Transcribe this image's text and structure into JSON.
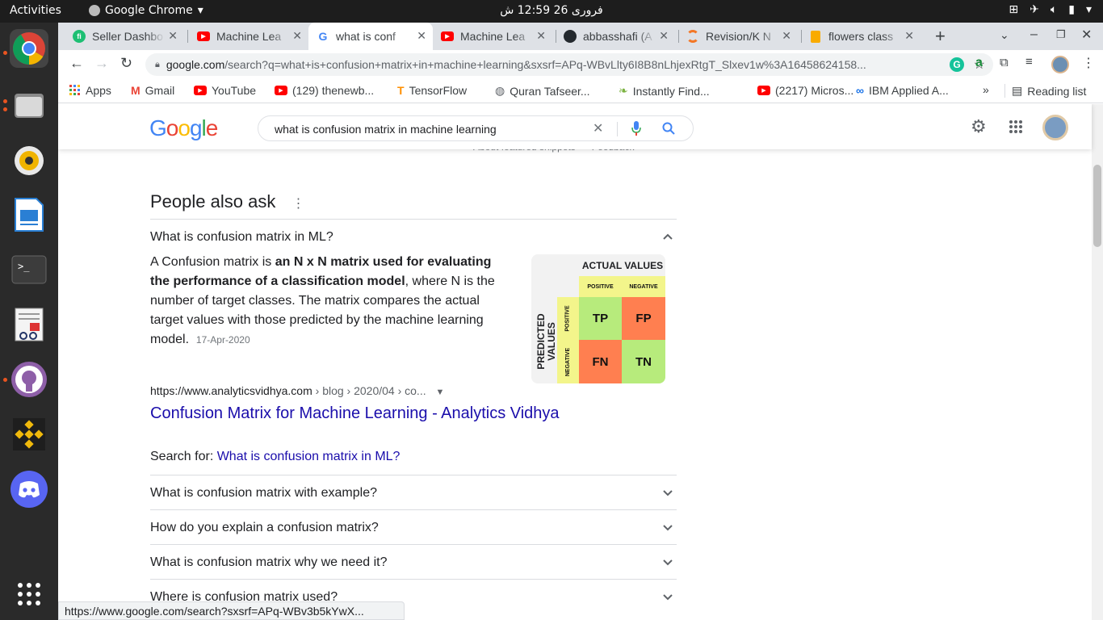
{
  "system": {
    "activities": "Activities",
    "app_name": "Google Chrome",
    "clock": "فروری 26  12:59 ش"
  },
  "tabs": [
    {
      "title": "Seller Dashbo",
      "favicon": "fiverr-icon",
      "color": "#1dbf73"
    },
    {
      "title": "Machine Lea",
      "favicon": "youtube-icon",
      "color": "#ff0000"
    },
    {
      "title": "what is conf",
      "favicon": "google-icon",
      "color": "#4285f4"
    },
    {
      "title": "Machine Lea",
      "favicon": "youtube-icon",
      "color": "#ff0000"
    },
    {
      "title": "abbasshafi (A",
      "favicon": "github-icon",
      "color": "#24292e"
    },
    {
      "title": "Revision/K N",
      "favicon": "jupyter-icon",
      "color": "#f37726"
    },
    {
      "title": "flowers class",
      "favicon": "notebook-icon",
      "color": "#f9ab00"
    }
  ],
  "toolbar": {
    "url_host": "google.com",
    "url_path": "/search?q=what+is+confusion+matrix+in+machine+learning&sxsrf=APq-WBvLlty6I8B8nLhjexRtgT_Slxev1w%3A16458624158..."
  },
  "bookmarks": [
    {
      "label": "Apps"
    },
    {
      "label": "Gmail"
    },
    {
      "label": "YouTube"
    },
    {
      "label": "(129) thenewb..."
    },
    {
      "label": "TensorFlow"
    },
    {
      "label": "Quran Tafseer..."
    },
    {
      "label": "Instantly Find..."
    },
    {
      "label": "(2217) Micros..."
    },
    {
      "label": "IBM Applied A..."
    }
  ],
  "bookmarks_more": "»",
  "reading_list": "Reading list",
  "search": {
    "query": "what is confusion matrix in machine learning"
  },
  "results": {
    "faded_top": "About featured snippets      Feedback",
    "paa_title": "People also ask",
    "expanded_question": "What is confusion matrix in ML?",
    "answer_pre": "A Confusion matrix is ",
    "answer_bold": "an N x N matrix used for evaluating the performance of a classification model",
    "answer_post": ", where N is the number of target classes. The matrix compares the actual target values with those predicted by the machine learning model.",
    "answer_date": "17-Apr-2020",
    "source_url": "https://www.analyticsvidhya.com",
    "source_crumb": " › blog › 2020/04 › co...",
    "result_title": "Confusion Matrix for Machine Learning - Analytics Vidhya",
    "search_for_label": "Search for: ",
    "search_for_link": "What is confusion matrix in ML?",
    "questions": [
      "What is confusion matrix with example?",
      "How do you explain a confusion matrix?",
      "What is confusion matrix why we need it?",
      "Where is confusion matrix used?"
    ]
  },
  "matrix": {
    "actual": "ACTUAL VALUES",
    "predicted": "PREDICTED VALUES",
    "positive": "POSITIVE",
    "negative": "NEGATIVE",
    "tp": "TP",
    "fp": "FP",
    "fn": "FN",
    "tn": "TN",
    "green": "#b7eb7c",
    "orange": "#ff7f50",
    "yellow": "#f3f58b"
  },
  "status_url": "https://www.google.com/search?sxsrf=APq-WBv3b5kYwX..."
}
